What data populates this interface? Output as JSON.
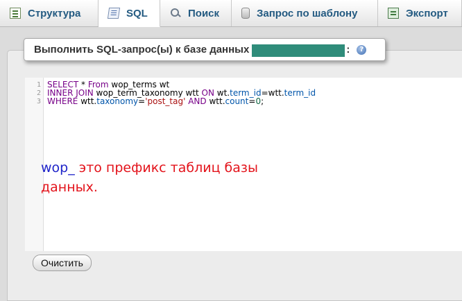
{
  "tabs": [
    {
      "label": "Структура",
      "icon": "structure-icon"
    },
    {
      "label": "SQL",
      "icon": "sql-icon",
      "active": true
    },
    {
      "label": "Поиск",
      "icon": "search-icon"
    },
    {
      "label": "Запрос по шаблону",
      "icon": "database-icon"
    },
    {
      "label": "Экспорт",
      "icon": "export-icon"
    }
  ],
  "query_box": {
    "legend_text": "Выполнить SQL-запрос(ы) к базе данных",
    "db_name_redacted": true,
    "colon": ":",
    "help_icon": "help-icon",
    "help_glyph": "?"
  },
  "editor": {
    "line_numbers": [
      "1",
      "2",
      "3"
    ],
    "lines": [
      [
        {
          "t": "SELECT",
          "c": "kw"
        },
        {
          "t": " * ",
          "c": "plain"
        },
        {
          "t": "From",
          "c": "kw"
        },
        {
          "t": " wop_terms wt",
          "c": "plain"
        }
      ],
      [
        {
          "t": "INNER JOIN",
          "c": "kw"
        },
        {
          "t": " wop_term_taxonomy wtt ",
          "c": "plain"
        },
        {
          "t": "ON",
          "c": "kw"
        },
        {
          "t": " wt.",
          "c": "plain"
        },
        {
          "t": "term_id",
          "c": "col"
        },
        {
          "t": "=wtt.",
          "c": "plain"
        },
        {
          "t": "term_id",
          "c": "col"
        }
      ],
      [
        {
          "t": "WHERE",
          "c": "kw"
        },
        {
          "t": " wtt.",
          "c": "plain"
        },
        {
          "t": "taxonomy",
          "c": "col"
        },
        {
          "t": "=",
          "c": "plain"
        },
        {
          "t": "'post_tag'",
          "c": "str"
        },
        {
          "t": " ",
          "c": "plain"
        },
        {
          "t": "AND",
          "c": "kw"
        },
        {
          "t": " wtt.",
          "c": "plain"
        },
        {
          "t": "count",
          "c": "col"
        },
        {
          "t": "=",
          "c": "plain"
        },
        {
          "t": "0",
          "c": "num"
        },
        {
          "t": ";",
          "c": "plain"
        }
      ]
    ],
    "annotation": {
      "prefix": "wop_",
      "line1_rest": " это префикс таблиц базы",
      "line2": "данных."
    }
  },
  "buttons": {
    "clear_label": "Очистить"
  },
  "colors": {
    "tab_text": "#235a81",
    "annotation_prefix": "#1f24c9",
    "annotation_text": "#e3131b"
  }
}
